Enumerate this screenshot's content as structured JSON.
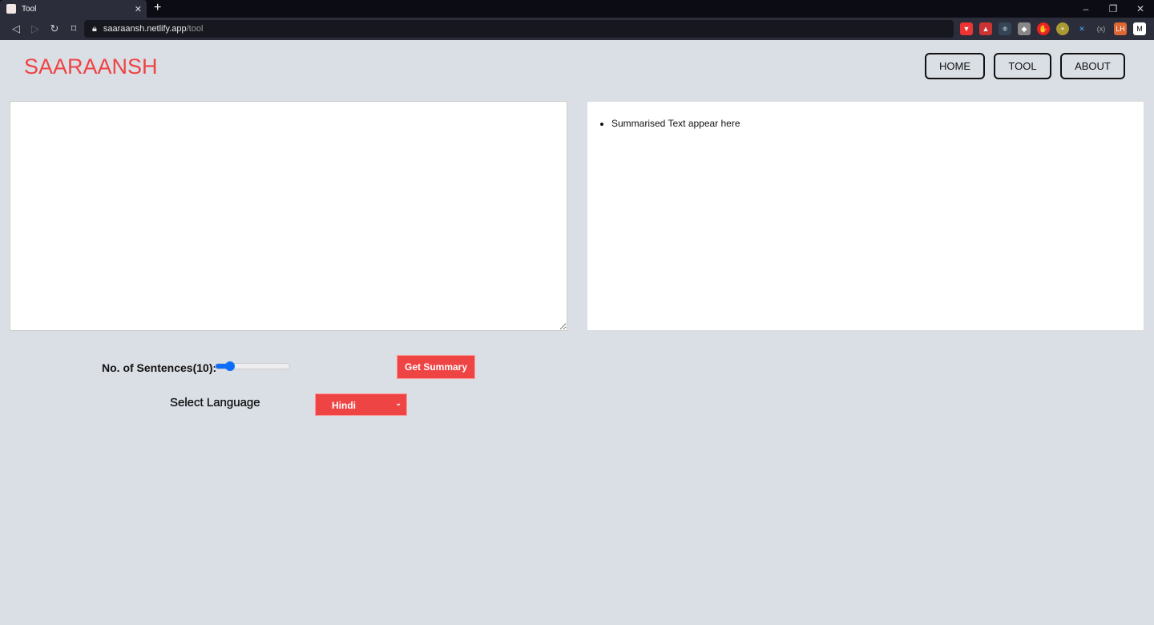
{
  "browser": {
    "tab_title": "Tool",
    "url_host": "saaraansh.netlify.app",
    "url_path": "/tool"
  },
  "site": {
    "logo": "SAARAANSH",
    "nav": [
      "HOME",
      "TOOL",
      "ABOUT"
    ]
  },
  "output": {
    "items": [
      "Summarised Text appear here"
    ]
  },
  "input": {
    "value": "",
    "placeholder": ""
  },
  "controls": {
    "sentences_label": "No. of Sentences(10):",
    "sentences_value": 10,
    "slider_fill_fraction": 0.2,
    "summary_button": "Get Summary",
    "language_label": "Select Language",
    "language_selected": "Hindi"
  },
  "colors": {
    "accent": "#ef4444",
    "slider": "#0d6efd",
    "background": "#dadee5"
  }
}
